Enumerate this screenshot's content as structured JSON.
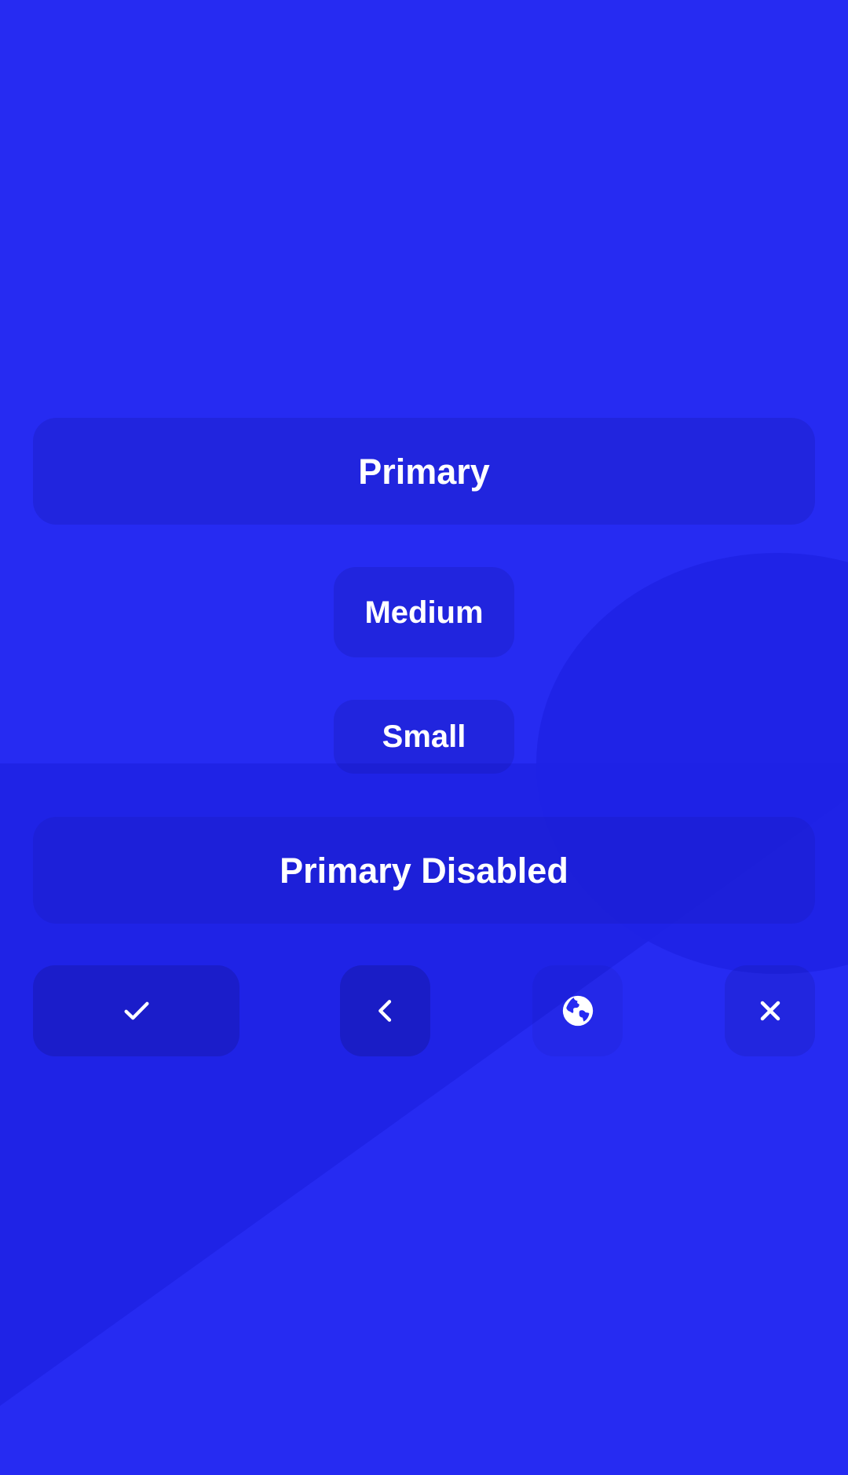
{
  "colors": {
    "background": "#262bf2",
    "background_shade": "#1f23e6",
    "button_overlay": "#1c1fd0",
    "text": "#ffffff"
  },
  "buttons": {
    "primary_label": "Primary",
    "medium_label": "Medium",
    "small_label": "Small",
    "primary_disabled_label": "Primary Disabled"
  },
  "icon_buttons": [
    {
      "icon": "check-icon"
    },
    {
      "icon": "chevron-left-icon"
    },
    {
      "icon": "globe-icon"
    },
    {
      "icon": "close-icon"
    }
  ]
}
